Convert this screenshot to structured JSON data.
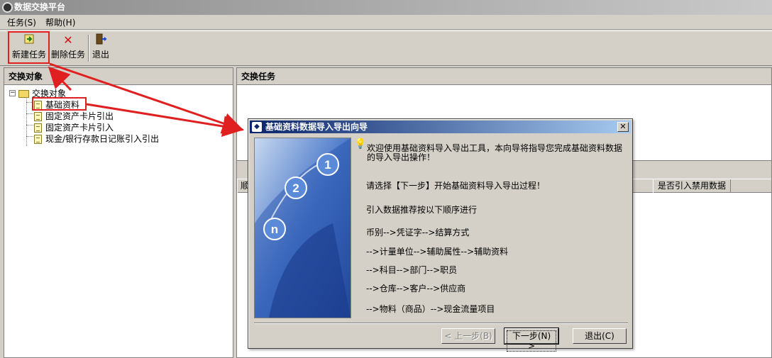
{
  "window": {
    "title": "数据交换平台"
  },
  "menu": {
    "items": [
      "任务(S)",
      "帮助(H)"
    ]
  },
  "toolbar": {
    "new_task": "新建任务",
    "delete_task": "删除任务",
    "exit": "退出"
  },
  "left_panel": {
    "header": "交换对象",
    "tree": {
      "root": "交换对象",
      "children": [
        "基础资料",
        "固定资产卡片引出",
        "固定资产卡片引入",
        "现金/银行存款日记账引入引出"
      ]
    }
  },
  "right_panel": {
    "header": "交换任务",
    "grid_columns": [
      "顺",
      "是否引入禁用数据"
    ]
  },
  "dialog": {
    "title": "基础资料数据导入导出向导",
    "image_numbers": [
      "1",
      "2",
      "n"
    ],
    "intro_line1": "欢迎使用基础资料导入导出工具，本向导将指导您完成基础资料数据",
    "intro_line2": "的导入导出操作！",
    "instruction": "请选择【下一步】开始基础资料导入导出过程！",
    "order_title": "引入数据推荐按以下顺序进行",
    "steps": [
      "币别-->凭证字-->结算方式",
      "-->计量单位-->辅助属性-->辅助资料",
      "-->科目-->部门-->职员",
      "-->仓库-->客户-->供应商",
      "-->物料（商品）-->现金流量项目"
    ],
    "buttons": {
      "prev": "< 上一步(B)",
      "next": "下一步(N) >",
      "exit": "退出(C)"
    }
  },
  "colors": {
    "annotation_red": "#e02020",
    "dialog_title": "#0a246a",
    "chrome": "#d4d0c8"
  }
}
